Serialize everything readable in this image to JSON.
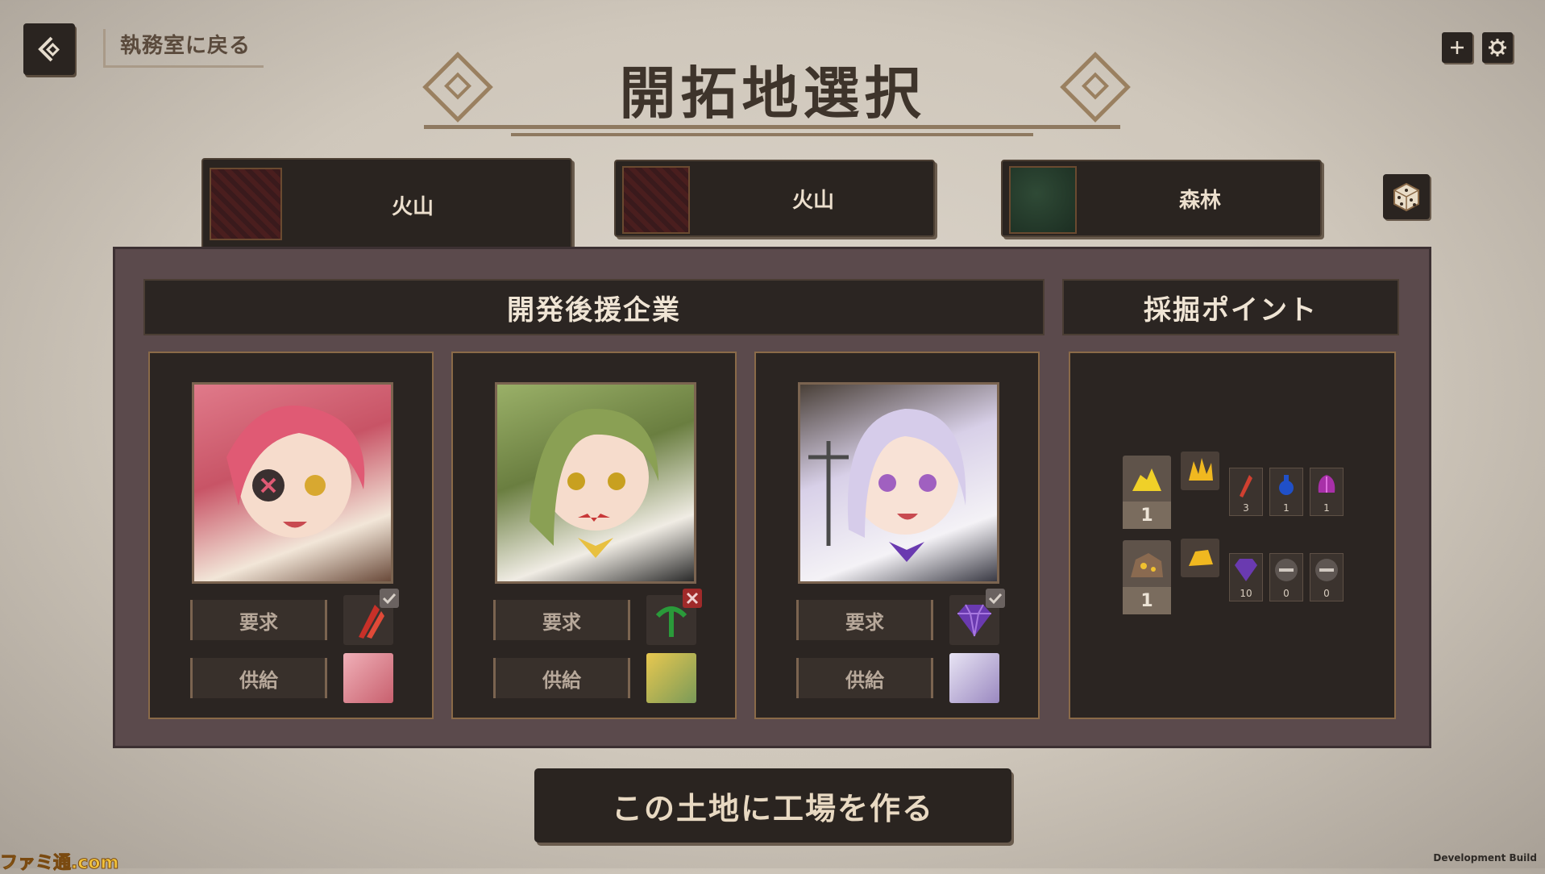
{
  "header": {
    "back_label": "執務室に戻る",
    "title": "開拓地選択"
  },
  "regions": [
    {
      "label": "火山",
      "kind": "volcano",
      "selected": true
    },
    {
      "label": "火山",
      "kind": "volcano",
      "selected": false
    },
    {
      "label": "森林",
      "kind": "forest",
      "selected": false
    }
  ],
  "panel": {
    "companies_header": "開発後援企業",
    "mining_header": "採掘ポイント"
  },
  "companies": [
    {
      "require_label": "要求",
      "supply_label": "供給",
      "require_icon": "red-crystal-icon",
      "status": "check"
    },
    {
      "require_label": "要求",
      "supply_label": "供給",
      "require_icon": "green-pickaxe-icon",
      "status": "cross"
    },
    {
      "require_label": "要求",
      "supply_label": "供給",
      "require_icon": "purple-gem-icon",
      "status": "check"
    }
  ],
  "mining": {
    "rows": [
      {
        "count": "1",
        "items": [
          {
            "icon": "red-crystal-icon",
            "n": "3"
          },
          {
            "icon": "blue-potion-icon",
            "n": "1"
          },
          {
            "icon": "purple-flower-icon",
            "n": "1"
          }
        ]
      },
      {
        "count": "1",
        "items": [
          {
            "icon": "purple-gem-icon",
            "n": "10"
          },
          {
            "icon": "empty-icon",
            "n": "0"
          },
          {
            "icon": "empty-icon",
            "n": "0"
          }
        ]
      }
    ]
  },
  "action": {
    "build_label": "この土地に工場を作る"
  },
  "footer": {
    "watermark": "ファミ通.com",
    "build_tag": "Development Build"
  },
  "colors": {
    "accent": "#8a6a48",
    "panel": "#5b4a4c",
    "dark": "#2b2522"
  }
}
